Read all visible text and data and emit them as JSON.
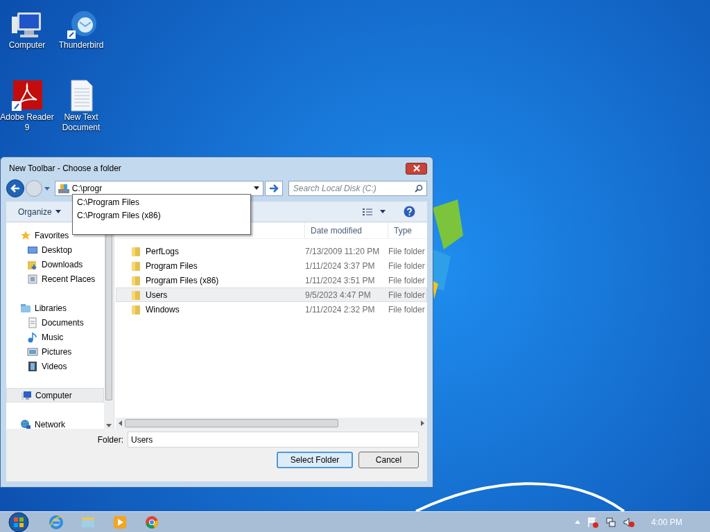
{
  "desktop_icons": [
    {
      "kind": "computer",
      "label": "Computer"
    },
    {
      "kind": "mail",
      "label": "Thunderbird"
    },
    {
      "kind": "pdf",
      "label": "Adobe Reader 9"
    },
    {
      "kind": "text",
      "label": "New Text Document"
    }
  ],
  "dialog": {
    "title": "New Toolbar - Choose a folder",
    "address": {
      "value": "C:\\progr"
    },
    "search": {
      "placeholder": "Search Local Disk (C:)"
    },
    "suggestions": [
      "C:\\Program Files",
      "C:\\Program Files (x86)"
    ],
    "toolbar": {
      "organize": "Organize"
    },
    "sidebar": [
      {
        "kind": "star",
        "label": "Favorites",
        "selected": false,
        "children": [
          {
            "kind": "desktop",
            "label": "Desktop",
            "selected": false
          },
          {
            "kind": "downloads",
            "label": "Downloads",
            "selected": false
          },
          {
            "kind": "recent",
            "label": "Recent Places",
            "selected": false
          }
        ]
      },
      {
        "kind": "library",
        "label": "Libraries",
        "selected": false,
        "children": [
          {
            "kind": "document",
            "label": "Documents",
            "selected": false
          },
          {
            "kind": "music",
            "label": "Music",
            "selected": false
          },
          {
            "kind": "picture",
            "label": "Pictures",
            "selected": false
          },
          {
            "kind": "video",
            "label": "Videos",
            "selected": false
          }
        ]
      },
      {
        "kind": "computer",
        "label": "Computer",
        "selected": true
      },
      {
        "kind": "network",
        "label": "Network",
        "selected": false
      }
    ],
    "columns": [
      "Date modified",
      "Type"
    ],
    "rows": [
      {
        "name": "PerfLogs",
        "date": "7/13/2009 11:20 PM",
        "type": "File folder",
        "selected": false
      },
      {
        "name": "Program Files",
        "date": "1/11/2024 3:37 PM",
        "type": "File folder",
        "selected": false
      },
      {
        "name": "Program Files (x86)",
        "date": "1/11/2024 3:51 PM",
        "type": "File folder",
        "selected": false
      },
      {
        "name": "Users",
        "date": "9/5/2023 4:47 PM",
        "type": "File folder",
        "selected": true
      },
      {
        "name": "Windows",
        "date": "1/11/2024 2:32 PM",
        "type": "File folder",
        "selected": false
      }
    ],
    "folder": {
      "label": "Folder:",
      "value": "Users"
    },
    "buttons": [
      "Select Folder",
      "Cancel"
    ]
  },
  "taskbar": {
    "apps": [
      {
        "kind": "ie"
      },
      {
        "kind": "explorer"
      },
      {
        "kind": "media"
      },
      {
        "kind": "chrome"
      }
    ],
    "clock": "4:00 PM"
  }
}
